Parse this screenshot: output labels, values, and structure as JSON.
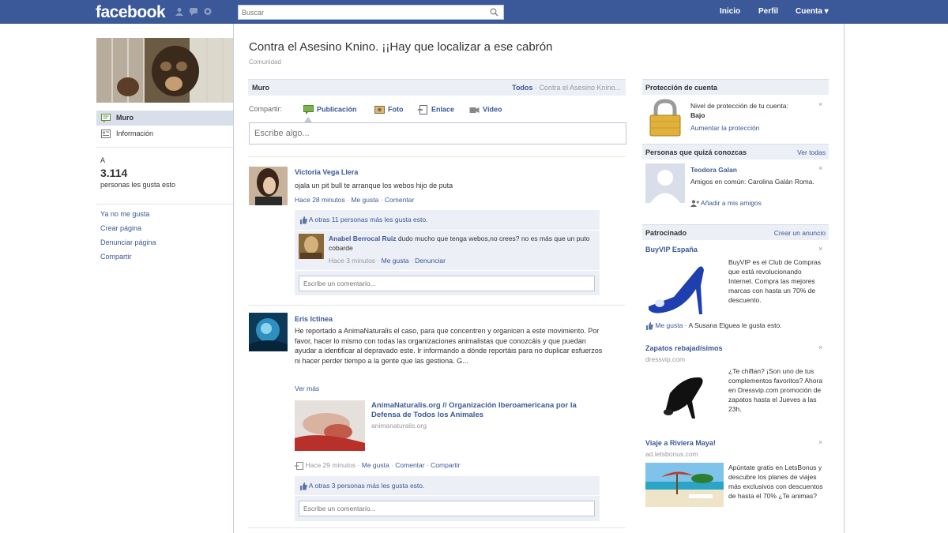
{
  "header": {
    "logo": "facebook",
    "search_placeholder": "Buscar",
    "nav": {
      "inicio": "Inicio",
      "perfil": "Perfil",
      "cuenta": "Cuenta ▾"
    }
  },
  "page": {
    "title": "Contra el Asesino Knino. ¡¡Hay que localizar a ese cabrón",
    "category": "Comunidad"
  },
  "left_nav": {
    "items": [
      {
        "label": "Muro",
        "icon": "wall-icon",
        "active": true
      },
      {
        "label": "Información",
        "icon": "info-icon",
        "active": false
      }
    ],
    "likes_prefix": "A",
    "likes_count": "3.114",
    "likes_text": "personas les gusta esto",
    "links": [
      "Ya no me gusta",
      "Crear página",
      "Denunciar página",
      "Compartir"
    ]
  },
  "wall": {
    "tab": "Muro",
    "filter_all": "Todos",
    "filter_page": "Contra el Asesino Knino...",
    "share_label": "Compartir:",
    "share_options": [
      "Publicación",
      "Foto",
      "Enlace",
      "Vídeo"
    ],
    "composer_placeholder": "Escribe algo..."
  },
  "posts": [
    {
      "author": "Victoria Vega Llera",
      "text": "ojala un pit bull te arranque los webos hijo de puta",
      "time": "Hace 28 minutos",
      "like": "Me gusta",
      "comment": "Comentar",
      "likes_summary": "A otras 11 personas más les gusta esto.",
      "comments": [
        {
          "author": "Anabel Berrocal Ruiz",
          "text": "dudo mucho que tenga webos,no crees? no es más que un puto cobarde",
          "time": "Hace 3 minutos",
          "like": "Me gusta",
          "report": "Denunciar"
        }
      ],
      "comment_placeholder": "Escribe un comentario..."
    },
    {
      "author": "Eris Ictinea",
      "text": "He reportado a AnimaNaturalis el caso, para que concentren y organicen a este movimiento. Por favor, hacer lo mismo con todas las organizaciones animalistas que conozcáis y que puedan ayudar a identificar al depravado este. Ir informando a dónde reportáis para no duplicar esfuerzos ni hacer perder tiempo a la gente que las gestiona. G...",
      "see_more": "Ver más",
      "link_title": "AnimaNaturalis.org // Organización Iberoamericana por la Defensa de Todos los Animales",
      "link_domain": "animanaturalis.org",
      "time": "Hace 29 minutos",
      "like": "Me gusta",
      "comment": "Comentar",
      "share": "Compartir",
      "likes_summary": "A otras 3 personas más les gusta esto.",
      "comment_placeholder": "Escribe un comentario..."
    }
  ],
  "right": {
    "security": {
      "title": "Protección de cuenta",
      "level_label": "Nivel de protección de tu cuenta:",
      "level_value": "Bajo",
      "action": "Aumentar la protección"
    },
    "pymk": {
      "title": "Personas que quizá conozcas",
      "see_all": "Ver todas",
      "name": "Teodora Galan",
      "mutual": "Amigos en común: Carolina Galán Roma.",
      "add": "Añadir a mis amigos"
    },
    "sponsored": {
      "title": "Patrocinado",
      "create": "Crear un anuncio",
      "ads": [
        {
          "title": "BuyVIP España",
          "text": "BuyVIP es el Club de Compras que está revolucionando Internet. Compra las mejores marcas con hasta un 70% de descuento.",
          "like": "Me gusta",
          "social": "A Susana Elguea le gusta esto."
        },
        {
          "title": "Zapatos rebajadísimos",
          "domain": "dressvip.com",
          "text": "¿Te chiflan? ¡Son uno de tus complementos favoritos? Ahora en Dressvip.com promoción de zapatos hasta el Jueves a las 23h."
        },
        {
          "title": "Viaje a Riviera Maya!",
          "domain": "ad.letsbonus.com",
          "text": "Apúntate gratis en LetsBonus y descubre los planes de viajes más exclusivos con descuentos de hasta el 70% ¿Te animas?"
        }
      ]
    }
  }
}
